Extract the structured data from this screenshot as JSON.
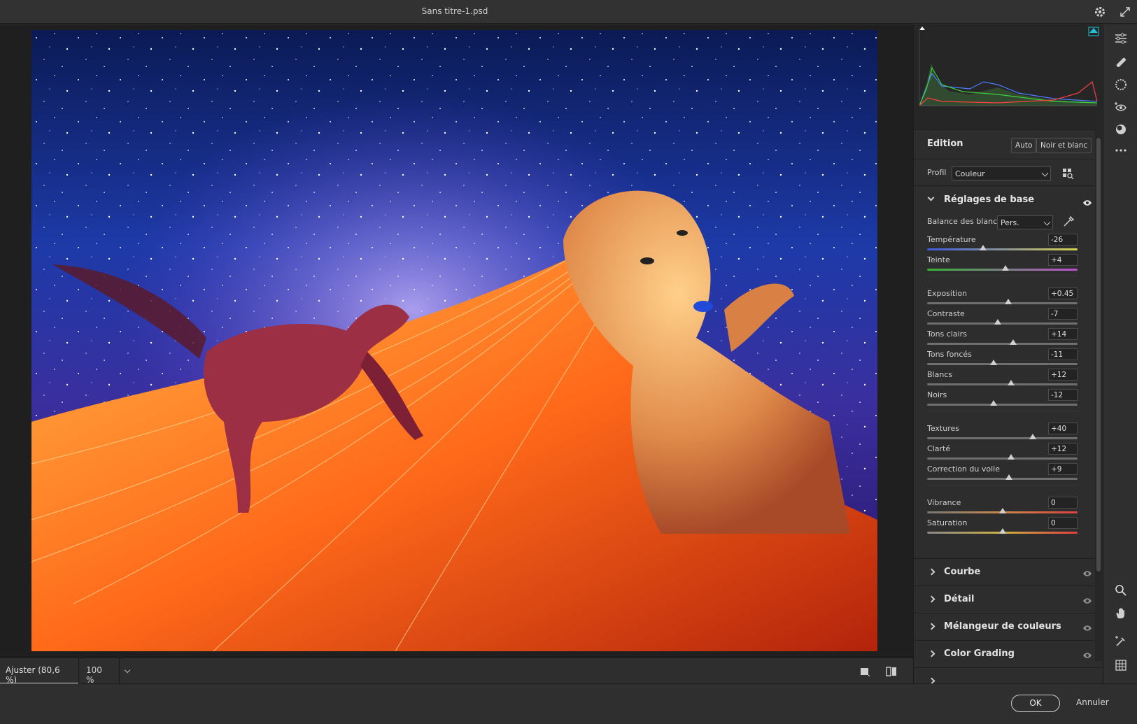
{
  "window": {
    "title": "Sans titre-1.psd"
  },
  "status": {
    "fit_label": "Ajuster (80,6 %)",
    "zoom_label": "100 %"
  },
  "edition": {
    "title": "Edition",
    "auto_label": "Auto",
    "bw_label": "Noir et blanc"
  },
  "profile": {
    "label": "Profil",
    "value": "Couleur"
  },
  "basic": {
    "title": "Réglages de base",
    "wb_label": "Balance des blancs",
    "wb_value": "Pers.",
    "sliders": [
      {
        "name": "Température",
        "value": "-26",
        "pos": 0.37,
        "track": "temp"
      },
      {
        "name": "Teinte",
        "value": "+4",
        "pos": 0.52,
        "track": "tint"
      },
      {
        "name": "Exposition",
        "value": "+0.45",
        "pos": 0.54,
        "track": "gray"
      },
      {
        "name": "Contraste",
        "value": "-7",
        "pos": 0.47,
        "track": "gray"
      },
      {
        "name": "Tons clairs",
        "value": "+14",
        "pos": 0.57,
        "track": "gray"
      },
      {
        "name": "Tons foncés",
        "value": "-11",
        "pos": 0.44,
        "track": "gray"
      },
      {
        "name": "Blancs",
        "value": "+12",
        "pos": 0.56,
        "track": "gray"
      },
      {
        "name": "Noirs",
        "value": "-12",
        "pos": 0.44,
        "track": "gray"
      },
      {
        "name": "Textures",
        "value": "+40",
        "pos": 0.7,
        "track": "gray"
      },
      {
        "name": "Clarté",
        "value": "+12",
        "pos": 0.56,
        "track": "gray"
      },
      {
        "name": "Correction du voile",
        "value": "+9",
        "pos": 0.545,
        "track": "gray"
      },
      {
        "name": "Vibrance",
        "value": "0",
        "pos": 0.5,
        "track": "vib"
      },
      {
        "name": "Saturation",
        "value": "0",
        "pos": 0.5,
        "track": "sat"
      }
    ]
  },
  "sections": [
    {
      "title": "Courbe"
    },
    {
      "title": "Détail"
    },
    {
      "title": "Mélangeur de couleurs"
    },
    {
      "title": "Color Grading"
    }
  ],
  "footer": {
    "ok_label": "OK",
    "cancel_label": "Annuler"
  },
  "colors": {
    "accent": "#1fc0d8",
    "panel": "#2d2d2d",
    "canvas": "#1f1f1f"
  }
}
